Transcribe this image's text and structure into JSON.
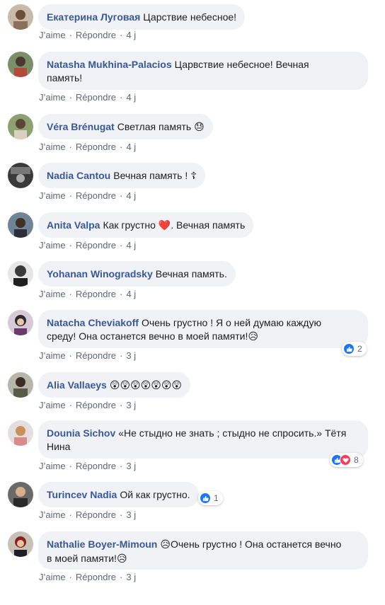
{
  "action_labels": {
    "like": "J’aime",
    "reply": "Répondre",
    "separator": "·"
  },
  "comments": [
    {
      "author": "Екатерина Луговая",
      "text": "Царствие небесное!",
      "time": "4 j"
    },
    {
      "author": "Natasha Mukhina-Palacios",
      "text_line1": "Царвствие небесное! Вечная",
      "text_line2": "память!",
      "time": "4 j"
    },
    {
      "author": "Véra Brénugat",
      "text": "Светлая память",
      "emoji": "😓",
      "time": "4 j"
    },
    {
      "author": "Nadia Cantou",
      "text": "Вечная память ! ☦",
      "time": "4 j"
    },
    {
      "author": "Anita Valpa",
      "text_before": "Как грустно",
      "emoji": "❤️",
      "text_after": ". Вечная память",
      "time": "4 j"
    },
    {
      "author": "Yohanan Winogradsky",
      "text": "Вечная память.",
      "time": "4 j"
    },
    {
      "author": "Natacha Cheviakoff",
      "text_line1": "Очень грустно ! Я о ней думаю каждую",
      "text_line2": "среду! Она останется вечно в моей памяти!",
      "emoji": "😥",
      "time": "3 j",
      "reaction_count": "2"
    },
    {
      "author": "Alia Vallaeys",
      "emoji": "😲😲😲😲😲😲😲",
      "time": "3 j"
    },
    {
      "author": "Dounia Sichov",
      "text_line1": "«Не стыдно не знать ; стыдно не спросить.» Тётя",
      "text_line2": "Нина",
      "time": "3 j",
      "reaction_count": "8"
    },
    {
      "author": "Turincev Nadia",
      "text": "Ой как грустно.",
      "time": "3 j",
      "reaction_count": "1"
    },
    {
      "author": "Nathalie Boyer-Mimoun",
      "emoji1": "😥",
      "text_line1": "Очень грустно ! Она останется вечно",
      "text_line2": "в моей памяти!",
      "emoji2": "😥",
      "time": "3 j"
    }
  ],
  "colors": {
    "author": "#385898",
    "bubble": "#f0f2f5",
    "meta": "#616770",
    "like": "#1877f2",
    "love": "#f33e58"
  }
}
